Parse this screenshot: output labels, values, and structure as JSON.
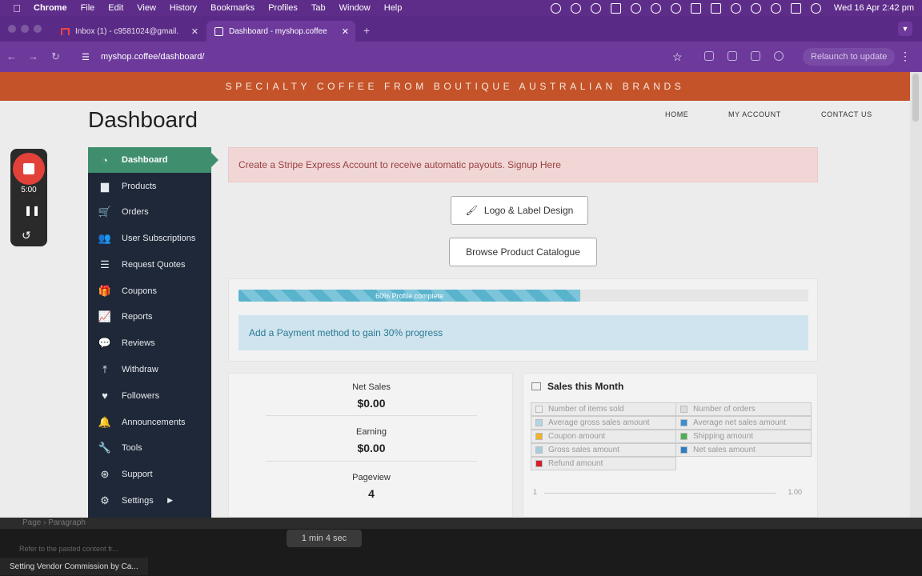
{
  "menubar": {
    "app": "Chrome",
    "items": [
      "File",
      "Edit",
      "View",
      "History",
      "Bookmarks",
      "Profiles",
      "Tab",
      "Window",
      "Help"
    ],
    "clock": "Wed 16 Apr  2:42 pm"
  },
  "tabs": [
    {
      "label": "Inbox (1) - c9581024@gmail.",
      "active": false
    },
    {
      "label": "Dashboard - myshop.coffee",
      "active": true
    }
  ],
  "address": {
    "url": "myshop.coffee/dashboard/",
    "relaunch": "Relaunch to update"
  },
  "site": {
    "banner": "SPECIALTY COFFEE FROM BOUTIQUE AUSTRALIAN BRANDS",
    "nav": [
      "HOME",
      "MY ACCOUNT",
      "CONTACT US"
    ],
    "title": "Dashboard"
  },
  "sidebar": {
    "items": [
      {
        "label": "Dashboard",
        "icon": "gauge-icon"
      },
      {
        "label": "Products",
        "icon": "briefcase-icon"
      },
      {
        "label": "Orders",
        "icon": "cart-icon"
      },
      {
        "label": "User Subscriptions",
        "icon": "users-icon"
      },
      {
        "label": "Request Quotes",
        "icon": "list-icon"
      },
      {
        "label": "Coupons",
        "icon": "gift-icon"
      },
      {
        "label": "Reports",
        "icon": "chart-line-icon"
      },
      {
        "label": "Reviews",
        "icon": "comments-icon"
      },
      {
        "label": "Withdraw",
        "icon": "upload-icon"
      },
      {
        "label": "Followers",
        "icon": "heart-icon"
      },
      {
        "label": "Announcements",
        "icon": "bell-icon"
      },
      {
        "label": "Tools",
        "icon": "wrench-icon"
      },
      {
        "label": "Support",
        "icon": "lifebuoy-icon"
      },
      {
        "label": "Settings",
        "icon": "cog-icon"
      }
    ]
  },
  "main": {
    "alert": "Create a Stripe Express Account to receive automatic payouts. Signup Here",
    "logo_button": "Logo & Label Design",
    "catalogue_button": "Browse Product Catalogue",
    "progress": {
      "label": "60% Profile complete",
      "percent": 60
    },
    "info": "Add a Payment method to gain 30% progress",
    "stats": [
      {
        "label": "Net Sales",
        "value": "$0.00"
      },
      {
        "label": "Earning",
        "value": "$0.00"
      },
      {
        "label": "Pageview",
        "value": "4"
      }
    ],
    "sales": {
      "title": "Sales this Month",
      "legend": [
        {
          "label": "Number of items sold",
          "color": "#eeeeee"
        },
        {
          "label": "Number of orders",
          "color": "#dcdcdc"
        },
        {
          "label": "Average gross sales amount",
          "color": "#b3d6e6"
        },
        {
          "label": "Average net sales amount",
          "color": "#3b8fcf"
        },
        {
          "label": "Coupon amount",
          "color": "#f0b429"
        },
        {
          "label": "Shipping amount",
          "color": "#4caf50"
        },
        {
          "label": "Gross sales amount",
          "color": "#a9cde0"
        },
        {
          "label": "Net sales amount",
          "color": "#2a7fc4"
        },
        {
          "label": "Refund amount",
          "color": "#d0212d"
        }
      ],
      "axis_left": "1",
      "axis_right": "1.00"
    }
  },
  "recorder": {
    "time": "5:00"
  },
  "background": {
    "breadcrumb": "Page  ›  Paragraph",
    "timer": "1 min 4 sec",
    "status": "Setting Vendor Commission by Ca...",
    "hint": "Refer to the pasted content fr..."
  }
}
